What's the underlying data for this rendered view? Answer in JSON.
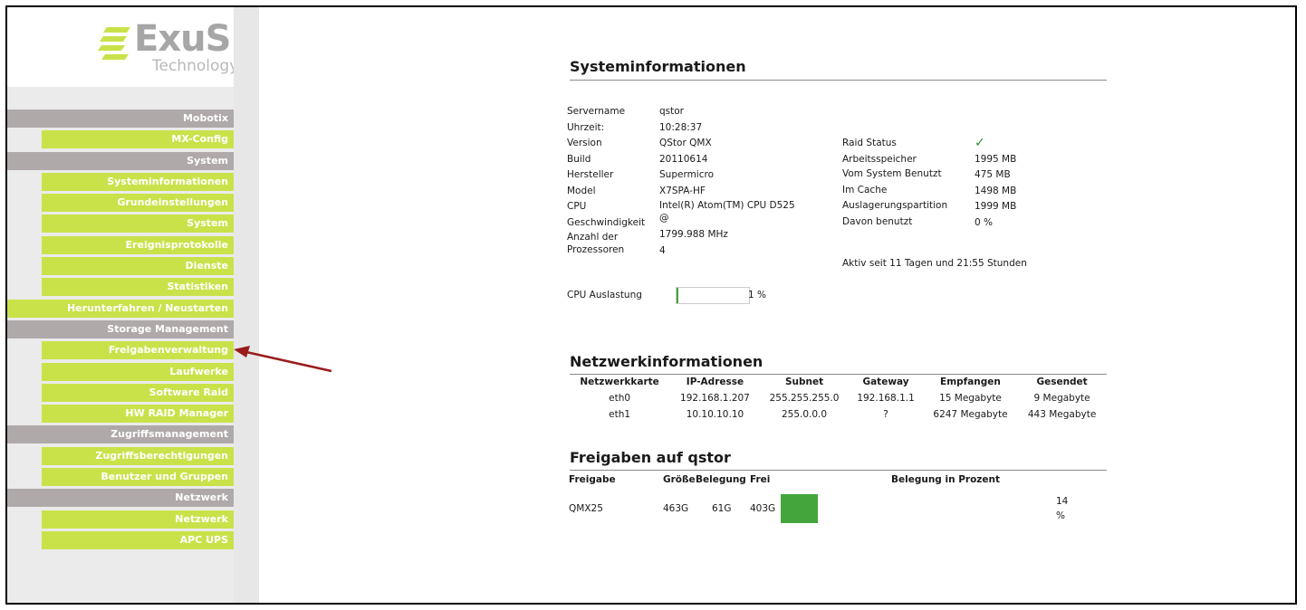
{
  "logo": {
    "main": "ExuS",
    "sub": "Technology",
    "mark_color": "#c9e24a"
  },
  "menu": [
    {
      "type": "group",
      "label": "Mobotix"
    },
    {
      "type": "leaf",
      "label": "MX-Config"
    },
    {
      "type": "group",
      "label": "System"
    },
    {
      "type": "leaf",
      "label": "Systeminformationen"
    },
    {
      "type": "leaf",
      "label": "Grundeinstellungen"
    },
    {
      "type": "leaf",
      "label": "System"
    },
    {
      "type": "leaf",
      "label": "Ereignisprotokolle"
    },
    {
      "type": "leaf",
      "label": "Dienste"
    },
    {
      "type": "leaf",
      "label": "Statistiken"
    },
    {
      "type": "leaf",
      "label": "Herunterfahren / Neustarten"
    },
    {
      "type": "group",
      "label": "Storage Management"
    },
    {
      "type": "leaf",
      "label": "Freigabenverwaltung"
    },
    {
      "type": "leaf",
      "label": "Laufwerke"
    },
    {
      "type": "leaf",
      "label": "Software Raid"
    },
    {
      "type": "leaf",
      "label": "HW RAID Manager"
    },
    {
      "type": "group",
      "label": "Zugriffsmanagement"
    },
    {
      "type": "leaf",
      "label": "Zugriffsberechtigungen"
    },
    {
      "type": "leaf",
      "label": "Benutzer und Gruppen"
    },
    {
      "type": "group",
      "label": "Netzwerk"
    },
    {
      "type": "leaf",
      "label": "Netzwerk"
    },
    {
      "type": "leaf",
      "label": "APC UPS"
    }
  ],
  "sysinfo": {
    "title": "Systeminformationen",
    "left_labels": [
      "Servername",
      "Uhrzeit:",
      "Version",
      "Build",
      "Hersteller",
      "Model",
      "CPU",
      "Geschwindigkeit",
      "Anzahl der Prozessoren"
    ],
    "left_values": [
      "qstor",
      "10:28:37",
      "QStor QMX",
      "20110614",
      "Supermicro",
      "X7SPA-HF",
      "Intel(R) Atom(TM) CPU D525 @",
      "1799.988 MHz",
      "4"
    ],
    "right_labels": [
      "Raid Status",
      "Arbeitsspeicher",
      "Vom System Benutzt",
      "Im Cache",
      "Auslagerungspartition",
      "Davon benutzt"
    ],
    "right_values": [
      "✓",
      "1995 MB",
      "475 MB",
      "1498 MB",
      "1999 MB",
      "0 %"
    ],
    "uptime": "Aktiv seit 11 Tagen und 21:55 Stunden",
    "cpu_label": "CPU Auslastung",
    "cpu_value": "1 %",
    "cpu_fraction": 0.01
  },
  "network": {
    "title": "Netzwerkinformationen",
    "headers": [
      "Netzwerkkarte",
      "IP-Adresse",
      "Subnet",
      "Gateway",
      "Empfangen",
      "Gesendet"
    ],
    "rows": [
      [
        "eth0",
        "192.168.1.207",
        "255.255.255.0",
        "192.168.1.1",
        "15 Megabyte",
        "9 Megabyte"
      ],
      [
        "eth1",
        "10.10.10.10",
        "255.0.0.0",
        "?",
        "6247 Megabyte",
        "443 Megabyte"
      ]
    ]
  },
  "shares": {
    "title": "Freigaben auf qstor",
    "headers": [
      "Freigabe",
      "Größe",
      "Belegung",
      "Frei",
      "Belegung in Prozent"
    ],
    "rows": [
      {
        "name": "QMX25",
        "size": "463G",
        "used": "61G",
        "free": "403G",
        "percent": "14 %",
        "fraction": 0.14
      }
    ]
  },
  "colors": {
    "group": "#afa9aa",
    "leaf": "#c9e24a",
    "bar": "#44a53c",
    "arrow": "#9b1b1b"
  }
}
